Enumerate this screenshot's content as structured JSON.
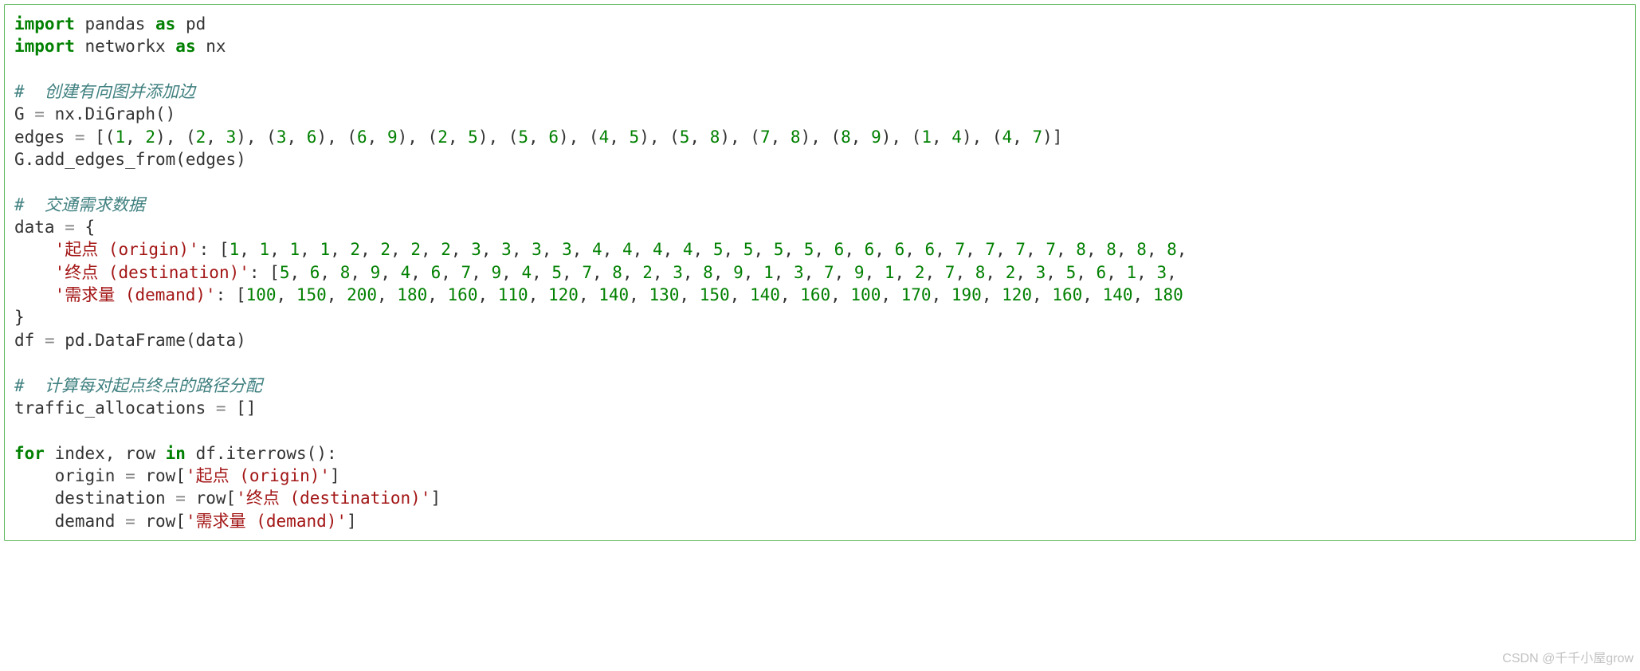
{
  "code": {
    "line1": {
      "kw1": "import",
      "mod1": " pandas ",
      "kw2": "as",
      "alias1": " pd"
    },
    "line2": {
      "kw1": "import",
      "mod1": " networkx ",
      "kw2": "as",
      "alias1": " nx"
    },
    "commentCreateGraph": "#  创建有向图并添加边",
    "gAssign": {
      "lhs": "G ",
      "eq": "=",
      "rhs": " nx.DiGraph()"
    },
    "edgesAssign": {
      "lhs": "edges ",
      "eq": "=",
      "open": " [(",
      "e1a": "1",
      "c": ", ",
      "e1b": "2",
      "sep": "), (",
      "e2a": "2",
      "e2b": "3",
      "e3a": "3",
      "e3b": "6",
      "e4a": "6",
      "e4b": "9",
      "e5a": "2",
      "e5b": "5",
      "e6a": "5",
      "e6b": "6",
      "e7a": "4",
      "e7b": "5",
      "e8a": "5",
      "e8b": "8",
      "e9a": "7",
      "e9b": "8",
      "e10a": "8",
      "e10b": "9",
      "e11a": "1",
      "e11b": "4",
      "e12a": "4",
      "e12b": "7",
      "close": ")]"
    },
    "addEdges": "G.add_edges_from(edges)",
    "commentTraffic": "#  交通需求数据",
    "dataOpen": {
      "lhs": "data ",
      "eq": "=",
      "rhs": " {"
    },
    "row1": {
      "indent": "    ",
      "key": "'起点 (origin)'",
      "colon": ": [",
      "vals": [
        "1",
        "1",
        "1",
        "1",
        "2",
        "2",
        "2",
        "2",
        "3",
        "3",
        "3",
        "3",
        "4",
        "4",
        "4",
        "4",
        "5",
        "5",
        "5",
        "5",
        "6",
        "6",
        "6",
        "6",
        "7",
        "7",
        "7",
        "7",
        "8",
        "8",
        "8",
        "8"
      ],
      "trail": ","
    },
    "row2": {
      "indent": "    ",
      "key": "'终点 (destination)'",
      "colon": ": [",
      "vals": [
        "5",
        "6",
        "8",
        "9",
        "4",
        "6",
        "7",
        "9",
        "4",
        "5",
        "7",
        "8",
        "2",
        "3",
        "8",
        "9",
        "1",
        "3",
        "7",
        "9",
        "1",
        "2",
        "7",
        "8",
        "2",
        "3",
        "5",
        "6",
        "1",
        "3"
      ],
      "trail": ","
    },
    "row3": {
      "indent": "    ",
      "key": "'需求量 (demand)'",
      "colon": ": [",
      "vals": [
        "100",
        "150",
        "200",
        "180",
        "160",
        "110",
        "120",
        "140",
        "130",
        "150",
        "140",
        "160",
        "100",
        "170",
        "190",
        "120",
        "160",
        "140",
        "180"
      ]
    },
    "dataClose": "}",
    "dfAssign": {
      "lhs": "df ",
      "eq": "=",
      "rhs": " pd.DataFrame(data)"
    },
    "commentCalc": "#  计算每对起点终点的路径分配",
    "allocAssign": {
      "lhs": "traffic_allocations ",
      "eq": "=",
      "rhs": " []"
    },
    "forLine": {
      "kw1": "for",
      "mid1": " index, row ",
      "kw2": "in",
      "mid2": " df.iterrows():"
    },
    "body1": {
      "indent": "    ",
      "lhs": "origin ",
      "eq": "=",
      "mid": " row[",
      "key": "'起点 (origin)'",
      "end": "]"
    },
    "body2": {
      "indent": "    ",
      "lhs": "destination ",
      "eq": "=",
      "mid": " row[",
      "key": "'终点 (destination)'",
      "end": "]"
    },
    "body3": {
      "indent": "    ",
      "lhs": "demand ",
      "eq": "=",
      "mid": " row[",
      "key": "'需求量 (demand)'",
      "end": "]"
    }
  },
  "watermark": "CSDN @千千小屋grow"
}
